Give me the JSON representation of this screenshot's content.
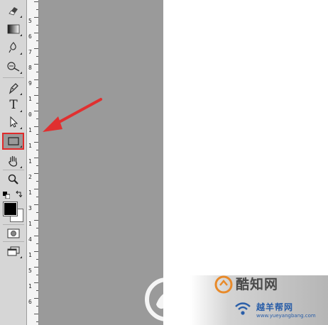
{
  "toolbar": {
    "tools": [
      {
        "name": "eraser-tool"
      },
      {
        "name": "gradient-tool"
      },
      {
        "name": "blur-tool"
      },
      {
        "name": "dodge-tool"
      },
      {
        "name": "pen-tool"
      },
      {
        "name": "type-tool",
        "glyph": "T"
      },
      {
        "name": "path-selection-tool"
      },
      {
        "name": "rectangle-tool",
        "selected": true
      },
      {
        "name": "hand-tool"
      },
      {
        "name": "zoom-tool"
      }
    ],
    "foreground_color": "#000000",
    "background_color": "#ffffff"
  },
  "ruler": {
    "labels": [
      "5",
      "6",
      "7",
      "8",
      "9",
      "1",
      "0",
      "1",
      "1",
      "1",
      "2",
      "1",
      "3",
      "1",
      "4",
      "1",
      "5",
      "1",
      "6"
    ]
  },
  "watermark": {
    "line1": "酷知网",
    "line2": "越羊帮网",
    "line3": "www.yueyangbang.com"
  },
  "colors": {
    "highlight": "#e02a2a",
    "arrow": "#e03030",
    "canvas_gray": "#9a9a9a",
    "canvas_white": "#ffffff"
  }
}
